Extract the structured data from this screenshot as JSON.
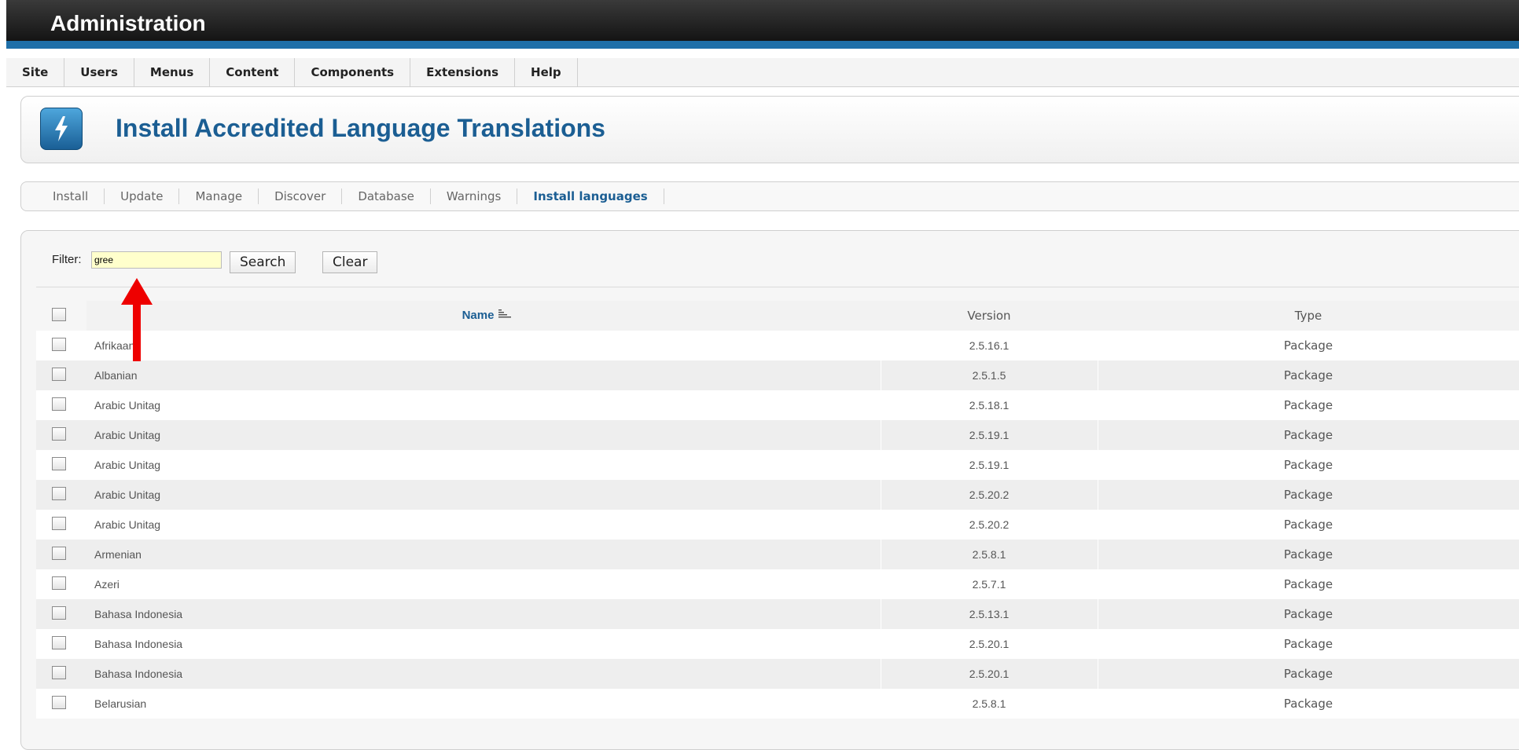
{
  "admin": {
    "title": "Administration"
  },
  "menu": [
    "Site",
    "Users",
    "Menus",
    "Content",
    "Components",
    "Extensions",
    "Help"
  ],
  "page": {
    "title": "Install Accredited Language Translations",
    "icon": "install-bolt-icon"
  },
  "submenu": {
    "items": [
      "Install",
      "Update",
      "Manage",
      "Discover",
      "Database",
      "Warnings",
      "Install languages"
    ],
    "active": "Install languages"
  },
  "filter": {
    "label": "Filter:",
    "value": "gree",
    "search_label": "Search",
    "clear_label": "Clear"
  },
  "table": {
    "columns": {
      "name": "Name",
      "version": "Version",
      "type": "Type"
    },
    "rows": [
      {
        "name": "Afrikaans",
        "version": "2.5.16.1",
        "type": "Package"
      },
      {
        "name": "Albanian",
        "version": "2.5.1.5",
        "type": "Package"
      },
      {
        "name": "Arabic Unitag",
        "version": "2.5.18.1",
        "type": "Package"
      },
      {
        "name": "Arabic Unitag",
        "version": "2.5.19.1",
        "type": "Package"
      },
      {
        "name": "Arabic Unitag",
        "version": "2.5.19.1",
        "type": "Package"
      },
      {
        "name": "Arabic Unitag",
        "version": "2.5.20.2",
        "type": "Package"
      },
      {
        "name": "Arabic Unitag",
        "version": "2.5.20.2",
        "type": "Package"
      },
      {
        "name": "Armenian",
        "version": "2.5.8.1",
        "type": "Package"
      },
      {
        "name": "Azeri",
        "version": "2.5.7.1",
        "type": "Package"
      },
      {
        "name": "Bahasa Indonesia",
        "version": "2.5.13.1",
        "type": "Package"
      },
      {
        "name": "Bahasa Indonesia",
        "version": "2.5.20.1",
        "type": "Package"
      },
      {
        "name": "Bahasa Indonesia",
        "version": "2.5.20.1",
        "type": "Package"
      },
      {
        "name": "Belarusian",
        "version": "2.5.8.1",
        "type": "Package"
      }
    ]
  },
  "annotation": {
    "icon": "red-up-arrow-icon",
    "color": "#ee0000"
  },
  "colors": {
    "accent": "#1b5e93",
    "header_bar": "#1e6fa8",
    "filter_bg": "#ffffcc"
  }
}
